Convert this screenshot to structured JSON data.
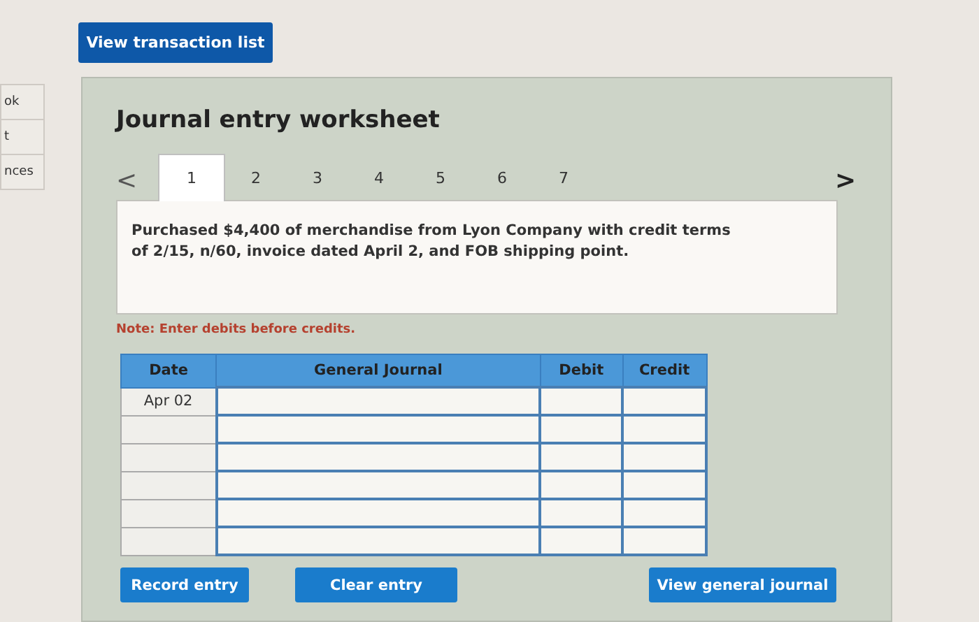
{
  "top_button": "View transaction list",
  "side_tabs": [
    {
      "label": "ok"
    },
    {
      "label": "t"
    },
    {
      "label": "nces"
    }
  ],
  "worksheet": {
    "title": "Journal entry worksheet",
    "prev": "<",
    "next": ">",
    "tabs": [
      {
        "label": "1",
        "selected": true
      },
      {
        "label": "2",
        "selected": false
      },
      {
        "label": "3",
        "selected": false
      },
      {
        "label": "4",
        "selected": false
      },
      {
        "label": "5",
        "selected": false
      },
      {
        "label": "6",
        "selected": false
      },
      {
        "label": "7",
        "selected": false
      }
    ],
    "description": "Purchased $4,400 of merchandise from Lyon Company with credit terms of 2/15, n/60, invoice dated April 2, and FOB shipping point.",
    "note": "Note: Enter debits before credits.",
    "table": {
      "columns": [
        "Date",
        "General Journal",
        "Debit",
        "Credit"
      ],
      "rows": [
        {
          "kind": "entry",
          "date": "Apr 02"
        },
        {
          "kind": "entry"
        },
        {
          "kind": "entry"
        },
        {
          "kind": "entry"
        },
        {
          "kind": "entry"
        },
        {
          "kind": "entry"
        }
      ]
    },
    "buttons": [
      "Record entry",
      "Clear entry",
      "View general journal"
    ]
  }
}
